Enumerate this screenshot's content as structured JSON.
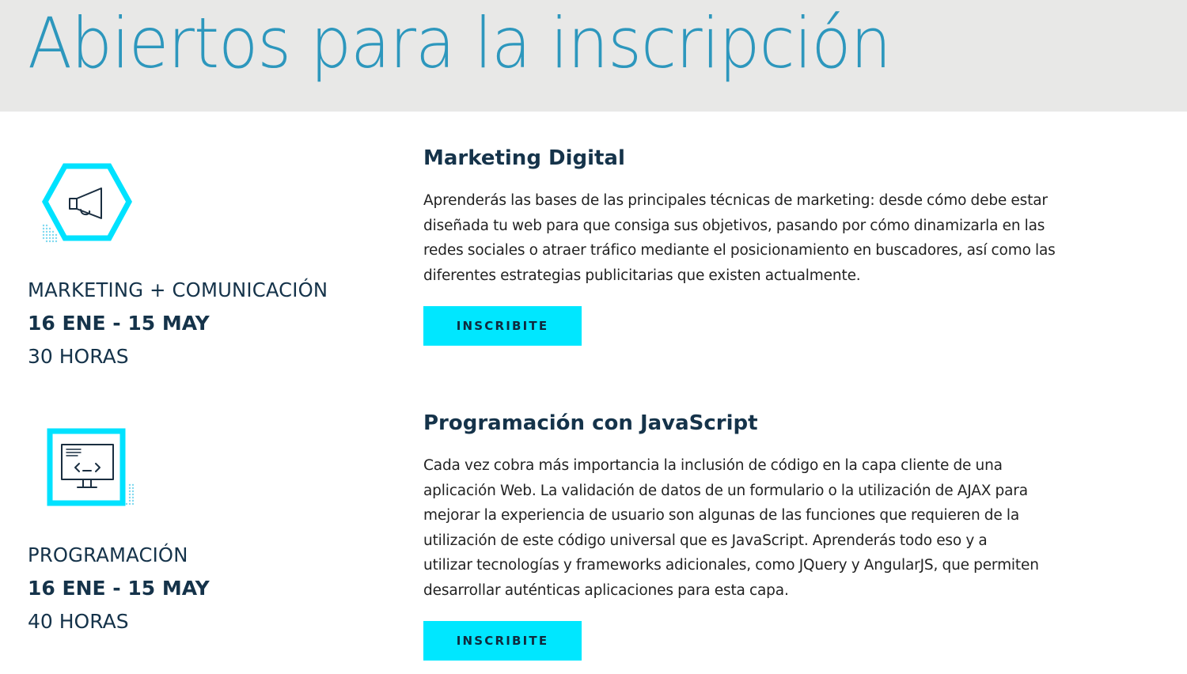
{
  "page": {
    "title": "Abiertos para la inscripción"
  },
  "colors": {
    "header_bg": "#e8e8e7",
    "title": "#2d97bd",
    "accent": "#00e7ff",
    "dark_text": "#15334a"
  },
  "courses": [
    {
      "icon": "megaphone-icon",
      "category": "MARKETING + COMUNICACIÓN",
      "dates": "16 ENE - 15 MAY",
      "hours": "30 HORAS",
      "title": "Marketing Digital",
      "description_lines": [
        "Aprenderás las bases de las principales técnicas de marketing: desde cómo debe estar",
        "diseñada tu web para que consiga sus objetivos, pasando por cómo dinamizarla en las",
        "redes sociales o atraer tráfico mediante el posicionamiento en buscadores, así como las",
        "diferentes estrategias publicitarias que existen actualmente."
      ],
      "button_label": "INSCRIBITE"
    },
    {
      "icon": "monitor-code-icon",
      "category": "PROGRAMACIÓN",
      "dates": "16 ENE - 15 MAY",
      "hours": "40 HORAS",
      "title": "Programación con JavaScript",
      "description_lines": [
        "Cada vez cobra más importancia la inclusión de código en la capa cliente de una",
        "aplicación Web. La validación de datos de un formulario o la utilización de AJAX para",
        "mejorar la experiencia de usuario son algunas de las funciones que requieren de la",
        "utilización de este código universal que es JavaScript. Aprenderás todo eso y a",
        "utilizar tecnologías y frameworks adicionales, como JQuery y AngularJS, que permiten",
        "desarrollar auténticas aplicaciones para esta capa."
      ],
      "button_label": "INSCRIBITE"
    }
  ]
}
